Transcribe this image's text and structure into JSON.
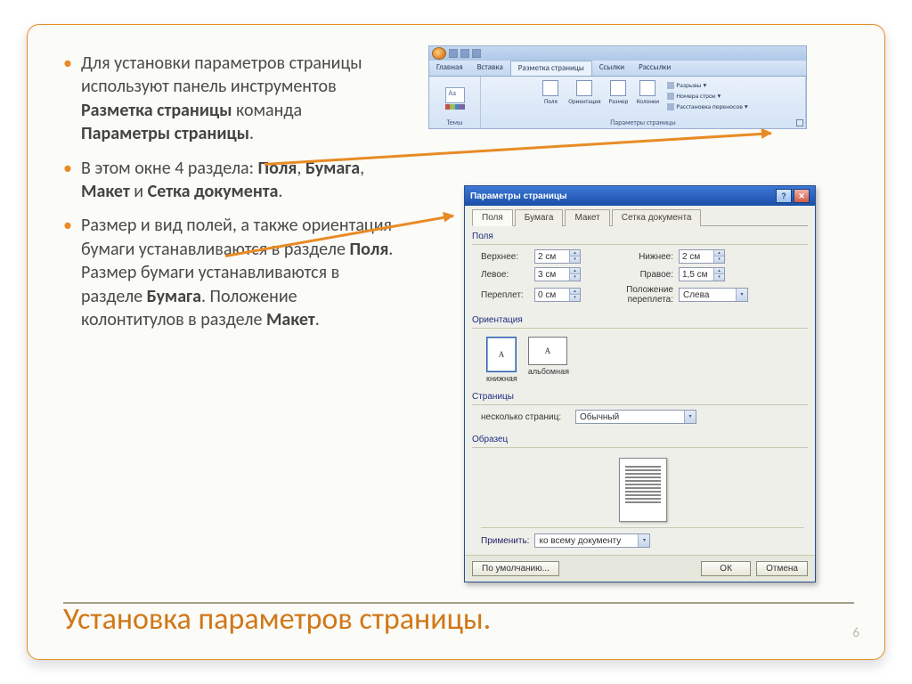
{
  "text": {
    "b1_a": "Для установки параметров страницы используют панель инструментов ",
    "b1_b": "Разметка страницы",
    "b1_c": " команда ",
    "b1_d": "Параметры страницы",
    "b1_e": ".",
    "b2_a": "В этом окне 4 раздела: ",
    "b2_b": "Поля",
    "b2_c": ", ",
    "b2_d": "Бумага",
    "b2_e": ", ",
    "b2_f": "Макет",
    "b2_g": " и ",
    "b2_h": "Сетка документа",
    "b2_i": ".",
    "b3_a": "Размер и вид полей, а также ориентация бумаги устанавливаются в разделе ",
    "b3_b": "Поля",
    "b3_c": ". Размер бумаги устанавливаются в разделе ",
    "b3_d": "Бумага",
    "b3_e": ". Положение колонтитулов в разделе ",
    "b3_f": "Макет",
    "b3_g": "."
  },
  "ribbon": {
    "tabs": {
      "home": "Главная",
      "insert": "Вставка",
      "layout": "Разметка страницы",
      "refs": "Ссылки",
      "mail": "Рассылки"
    },
    "groups": {
      "themes": {
        "label": "Темы",
        "btn": "Темы"
      },
      "page": {
        "label": "Параметры страницы",
        "margins": "Поля",
        "orientation": "Ориентация",
        "size": "Размер",
        "columns": "Колонки",
        "breaks": "Разрывы",
        "linenum": "Номера строк",
        "hyphen": "Расстановка переносов"
      }
    }
  },
  "dialog": {
    "title": "Параметры страницы",
    "tabs": {
      "fields": "Поля",
      "paper": "Бумага",
      "layout": "Макет",
      "grid": "Сетка документа"
    },
    "fields_group": "Поля",
    "labels": {
      "top": "Верхнее:",
      "bottom": "Нижнее:",
      "left": "Левое:",
      "right": "Правое:",
      "gutter": "Переплет:",
      "gutterpos": "Положение переплета:"
    },
    "values": {
      "top": "2 см",
      "bottom": "2 см",
      "left": "3 см",
      "right": "1,5 см",
      "gutter": "0 см",
      "gutterpos": "Слева"
    },
    "orientation_group": "Ориентация",
    "orientation": {
      "portrait": "книжная",
      "landscape": "альбомная"
    },
    "pages_group": "Страницы",
    "pages_label": "несколько страниц:",
    "pages_value": "Обычный",
    "preview_group": "Образец",
    "apply_label": "Применить:",
    "apply_value": "ко всему документу",
    "buttons": {
      "default": "По умолчанию...",
      "ok": "ОК",
      "cancel": "Отмена"
    }
  },
  "title": "Установка параметров страницы.",
  "page_number": "6"
}
